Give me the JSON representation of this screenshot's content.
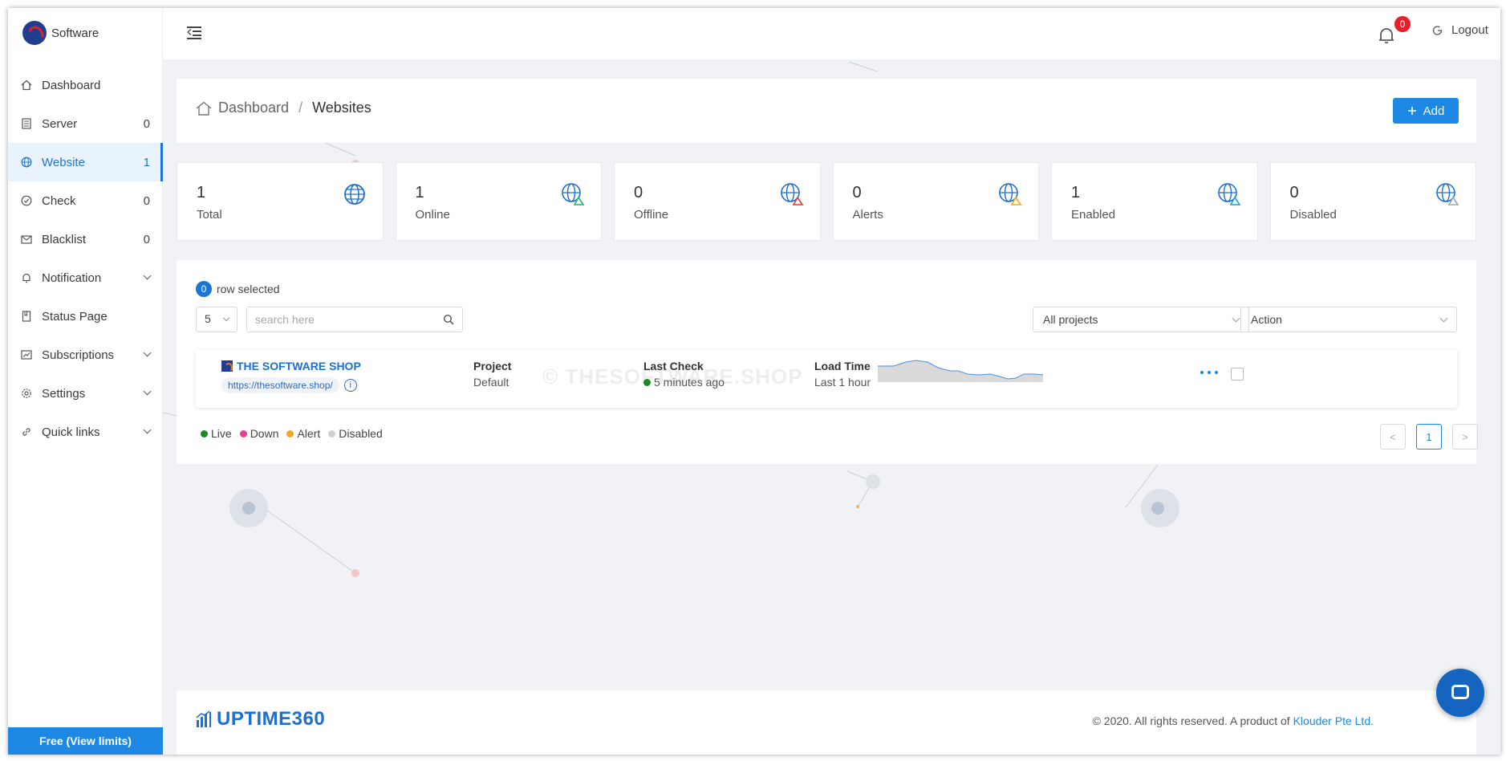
{
  "brand": {
    "name": "Software"
  },
  "sidebar": {
    "items": [
      {
        "label": "Dashboard",
        "count": ""
      },
      {
        "label": "Server",
        "count": "0"
      },
      {
        "label": "Website",
        "count": "1"
      },
      {
        "label": "Check",
        "count": "0"
      },
      {
        "label": "Blacklist",
        "count": "0"
      },
      {
        "label": "Notification",
        "count": ""
      },
      {
        "label": "Status Page",
        "count": ""
      },
      {
        "label": "Subscriptions",
        "count": ""
      },
      {
        "label": "Settings",
        "count": ""
      },
      {
        "label": "Quick links",
        "count": ""
      }
    ],
    "active_item": "Website",
    "plan_label": "Free (View limits)"
  },
  "topbar": {
    "notification_count": "0",
    "logout_label": "Logout"
  },
  "breadcrumb": {
    "home": "Dashboard",
    "separator": "/",
    "current": "Websites"
  },
  "header": {
    "add_label": "Add"
  },
  "stats": [
    {
      "value": "1",
      "label": "Total"
    },
    {
      "value": "1",
      "label": "Online"
    },
    {
      "value": "0",
      "label": "Offline"
    },
    {
      "value": "0",
      "label": "Alerts"
    },
    {
      "value": "1",
      "label": "Enabled"
    },
    {
      "value": "0",
      "label": "Disabled"
    }
  ],
  "list": {
    "selected_count": "0",
    "selected_text": "row selected",
    "page_size": "5",
    "search_placeholder": "search here",
    "project_filter": "All projects",
    "action_select": "Action"
  },
  "website_row": {
    "name": "THE SOFTWARE SHOP",
    "url": "https://thesoftware.shop/",
    "info": "i",
    "project_header": "Project",
    "project_value": "Default",
    "last_check_header": "Last Check",
    "last_check_value": "5 minutes ago",
    "load_time_header": "Load Time",
    "load_time_value": "Last 1 hour",
    "watermark": "© THESOFTWARE.SHOP"
  },
  "legend": [
    {
      "label": "Live",
      "color": "#1a8a25"
    },
    {
      "label": "Down",
      "color": "#ec3d8f"
    },
    {
      "label": "Alert",
      "color": "#f5a623"
    },
    {
      "label": "Disabled",
      "color": "#d0d0d0"
    }
  ],
  "pagination": {
    "prev": "<",
    "current": "1",
    "next": ">"
  },
  "footer": {
    "logo_text": "UPTIME360",
    "copyright": "© 2020. All rights reserved. A product of ",
    "company": "Klouder Pte Ltd."
  },
  "colors": {
    "accent": "#1e88e5",
    "badge": "#e91e2a",
    "live": "#1a8a25"
  }
}
